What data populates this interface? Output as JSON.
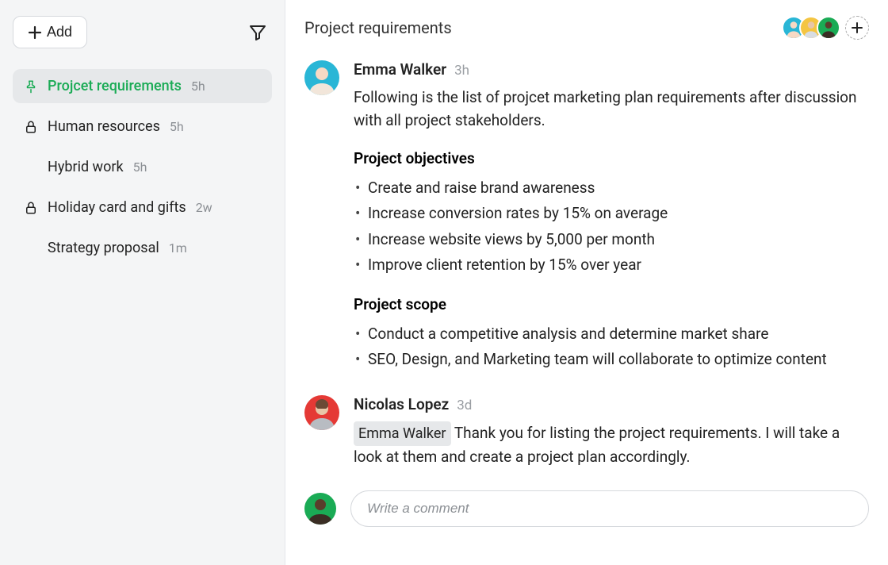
{
  "sidebar": {
    "add_label": "Add",
    "items": [
      {
        "label": "Projcet requirements",
        "time": "5h",
        "icon": "pin",
        "active": true
      },
      {
        "label": "Human resources",
        "time": "5h",
        "icon": "lock",
        "active": false
      },
      {
        "label": "Hybrid work",
        "time": "5h",
        "icon": "",
        "active": false
      },
      {
        "label": "Holiday card and gifts",
        "time": "2w",
        "icon": "lock",
        "active": false
      },
      {
        "label": "Strategy proposal",
        "time": "1m",
        "icon": "",
        "active": false
      }
    ]
  },
  "header": {
    "title": "Project requirements"
  },
  "posts": [
    {
      "author": "Emma Walker",
      "time": "3h",
      "text": "Following is the list of projcet marketing plan requirements after discussion with all project stakeholders.",
      "sections": [
        {
          "heading": "Project objectives",
          "items": [
            "Create and raise brand awareness",
            "Increase conversion rates by 15% on average",
            "Increase website views by 5,000 per month",
            "Improve client retention by 15% over year"
          ]
        },
        {
          "heading": "Project scope",
          "items": [
            "Conduct a competitive analysis and determine market share",
            "SEO, Design, and Marketing team will collaborate to optimize content"
          ]
        }
      ]
    },
    {
      "author": "Nicolas Lopez",
      "time": "3d",
      "mention": "Emma Walker",
      "text": "Thank you for listing the project requirements. I will take a look at them and create a project plan accordingly."
    }
  ],
  "comment": {
    "placeholder": "Write a comment"
  },
  "avatars": {
    "colors": [
      "#29b6d6",
      "#f4c542",
      "#1aab55"
    ]
  }
}
